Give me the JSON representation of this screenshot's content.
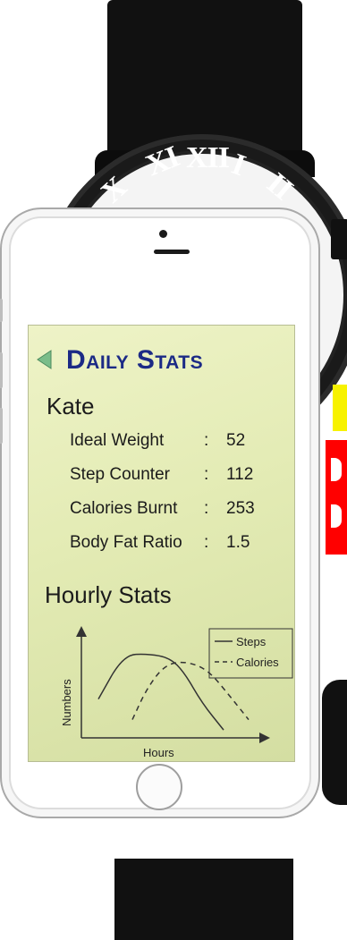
{
  "watch": {
    "numerals": [
      "XI",
      "XII",
      "I",
      "X",
      "II"
    ]
  },
  "screen": {
    "title": "Daily Stats",
    "back_icon": "back-triangle-icon",
    "user_name": "Kate",
    "stats": [
      {
        "label": "Ideal Weight",
        "value": "52"
      },
      {
        "label": "Step Counter",
        "value": "112"
      },
      {
        "label": "Calories Burnt",
        "value": "253"
      },
      {
        "label": "Body Fat Ratio",
        "value": "1.5"
      }
    ],
    "separator": ":",
    "chart_heading": "Hourly Stats"
  },
  "chart_data": {
    "type": "line",
    "xlabel": "Hours",
    "ylabel": "Numbers",
    "xlim": [
      0,
      10
    ],
    "ylim": [
      0,
      10
    ],
    "legend_position": "top-right",
    "series": [
      {
        "name": "Steps",
        "style": "solid",
        "x": [
          0.8,
          2.2,
          3.6,
          4.8,
          5.6,
          6.6,
          7.8
        ],
        "y": [
          3.6,
          7.9,
          8.0,
          7.6,
          6.2,
          3.2,
          0.6
        ]
      },
      {
        "name": "Calories",
        "style": "dashed",
        "x": [
          2.7,
          3.5,
          4.5,
          5.6,
          6.9,
          8.1,
          9.2
        ],
        "y": [
          1.6,
          4.6,
          6.9,
          7.3,
          6.5,
          4.0,
          1.6
        ]
      }
    ]
  },
  "colors": {
    "title": "#1c2a86",
    "back_icon": "#7bbd8a",
    "screen_bg": "#e3ebb4",
    "yellow": "#f7f200",
    "red": "#ff0000"
  }
}
